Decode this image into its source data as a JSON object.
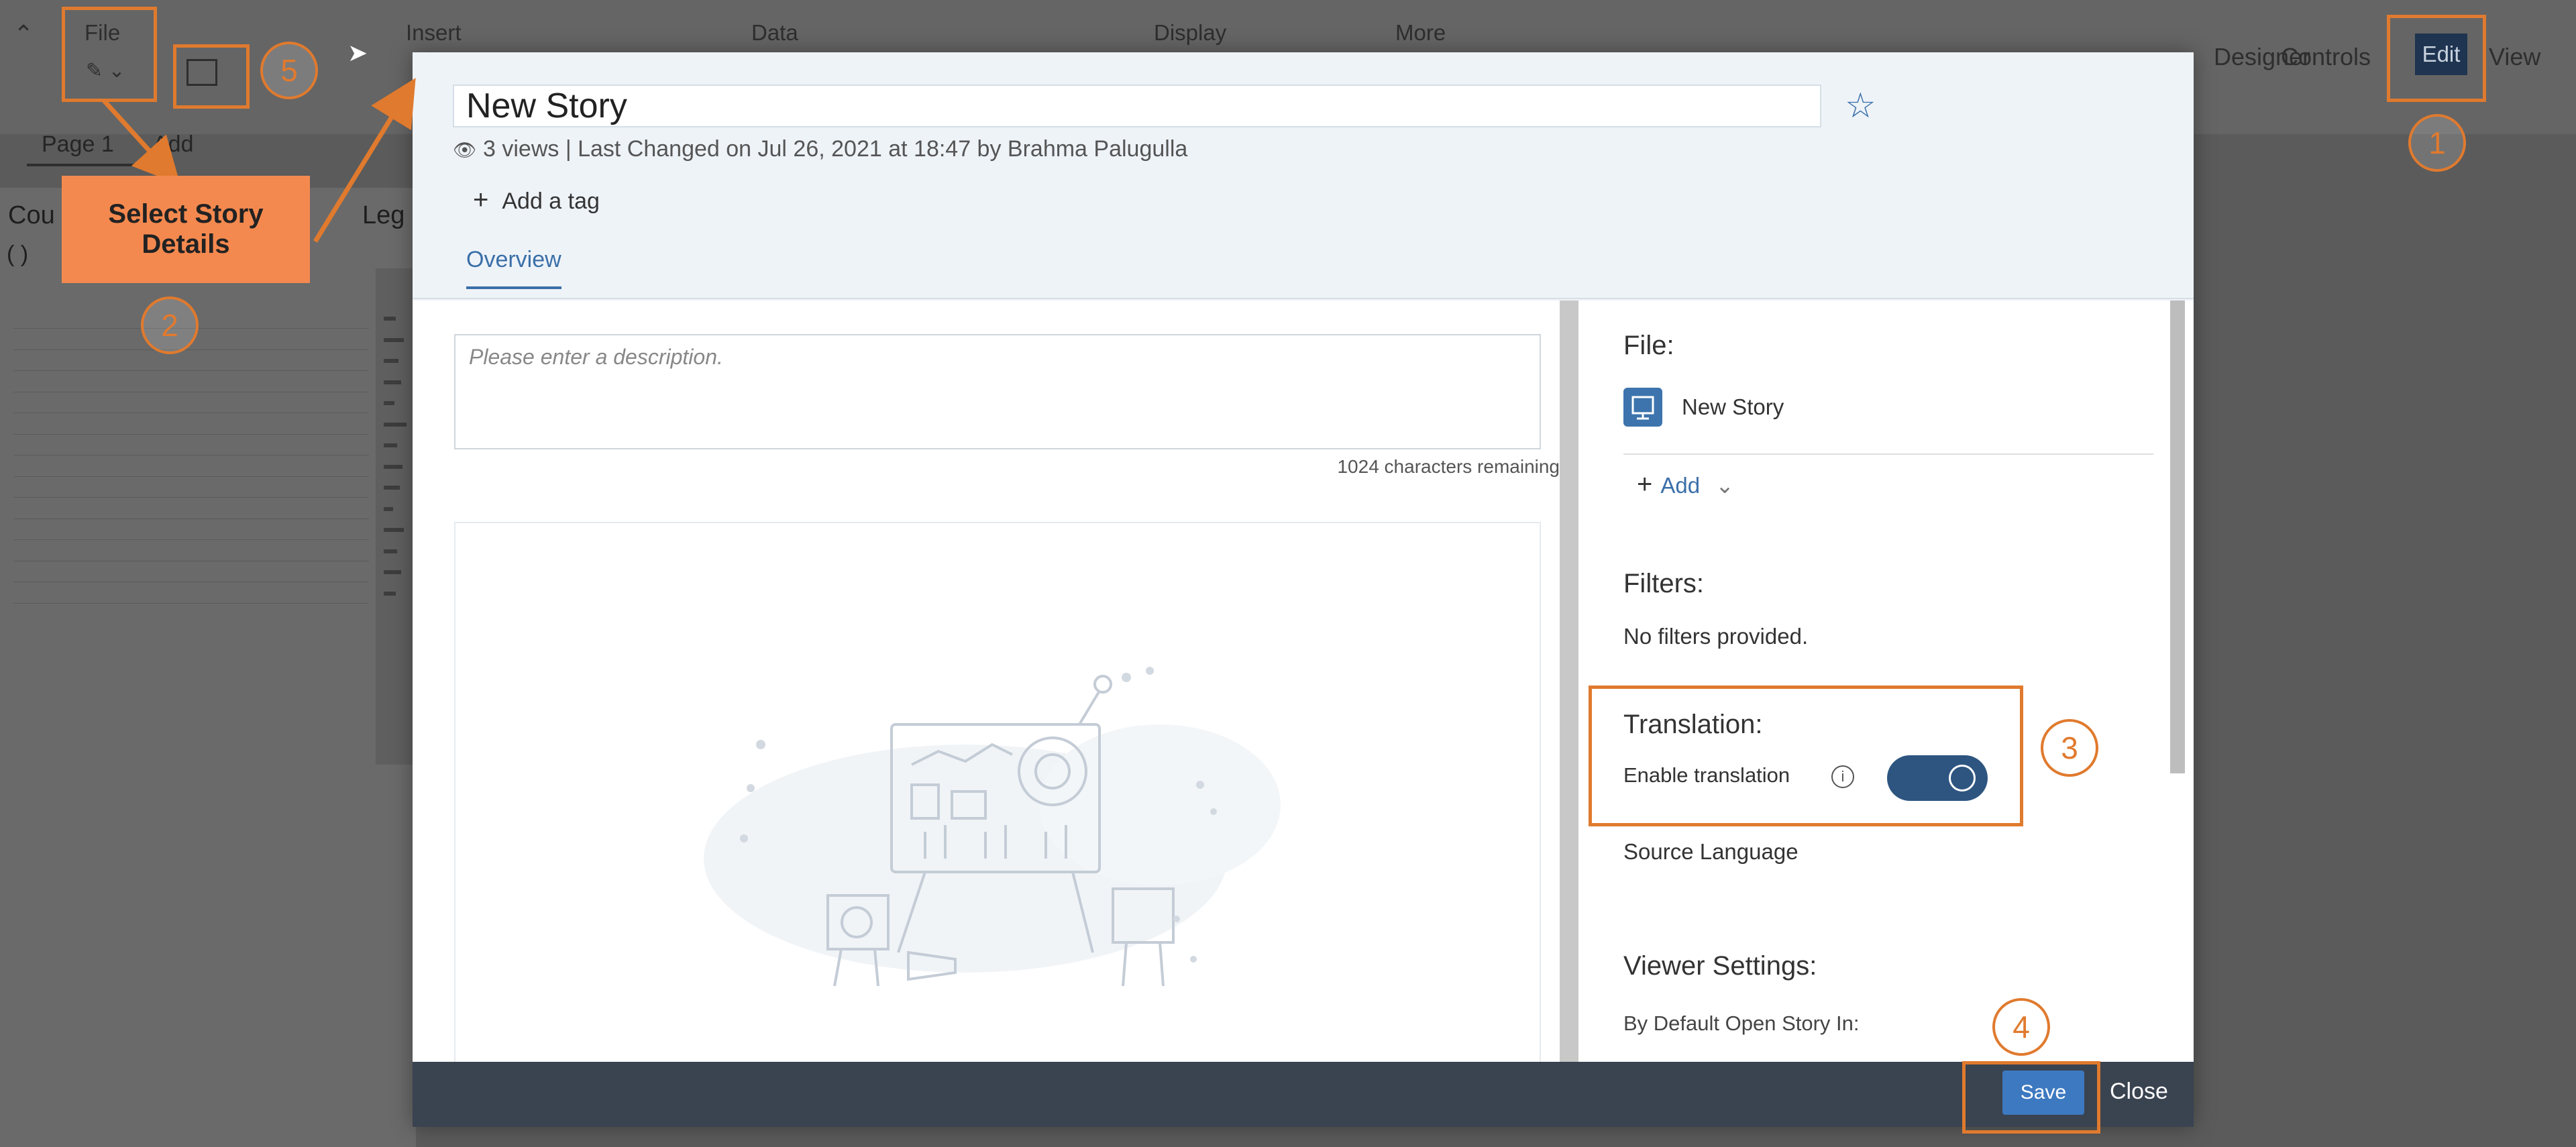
{
  "app": {
    "menu": {
      "file": "File",
      "insert": "Insert",
      "data": "Data",
      "display": "Display",
      "more": "More"
    },
    "right_menu": {
      "designer": "Designer",
      "controls": "Controls",
      "edit": "Edit",
      "view": "View"
    },
    "pages": {
      "page1": "Page 1",
      "add": "Add"
    },
    "left_fragments": {
      "a": "Cou",
      "b": "(  )",
      "c": "Leg"
    }
  },
  "modal": {
    "title": "New Story",
    "meta": "3 views | Last Changed on Jul 26, 2021 at 18:47 by Brahma Palugulla",
    "add_tag": "Add a tag",
    "tabs": [
      "Overview"
    ],
    "description_placeholder": "Please enter a description.",
    "chars_remaining": "1024 characters remaining",
    "side": {
      "file_heading": "File:",
      "file_name": "New Story",
      "add_label": "Add",
      "filters_heading": "Filters:",
      "no_filters": "No filters provided.",
      "translation_heading": "Translation:",
      "enable_translation": "Enable translation",
      "translation_enabled": true,
      "source_language": "Source Language",
      "viewer_heading": "Viewer Settings:",
      "default_open": "By Default Open Story In:"
    },
    "footer": {
      "save": "Save",
      "close": "Close"
    }
  },
  "annotations": {
    "callout": {
      "line1": "Select Story",
      "line2": "Details"
    },
    "steps": [
      "1",
      "2",
      "3",
      "4",
      "5"
    ],
    "color": "#e07a2e"
  }
}
